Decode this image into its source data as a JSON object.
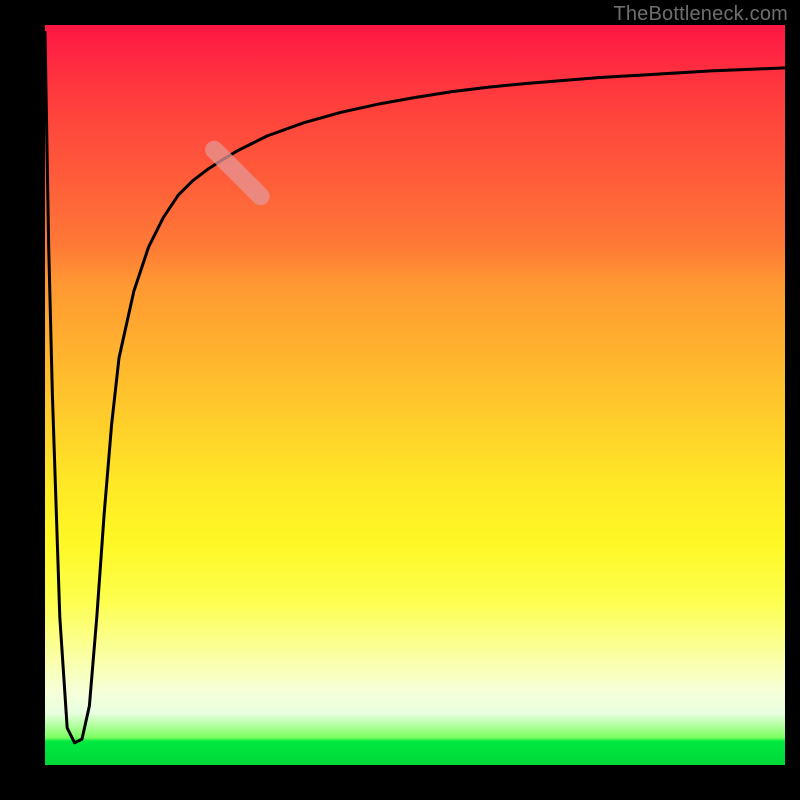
{
  "attribution": "TheBottleneck.com",
  "colors": {
    "background": "#000000",
    "curve": "#000000",
    "attribution_text": "#6e6e6e",
    "highlight_pill": "rgba(230,150,150,0.75)",
    "gradient_top": "#ff1744",
    "gradient_bottom": "#00d838"
  },
  "chart_data": {
    "type": "line",
    "title": "",
    "xlabel": "",
    "ylabel": "",
    "xlim": [
      0,
      1
    ],
    "ylim": [
      0,
      1
    ],
    "legend": false,
    "grid": false,
    "annotations": [
      {
        "kind": "highlight-pill",
        "x_range": [
          0.22,
          0.3
        ],
        "y_range": [
          0.76,
          0.84
        ]
      }
    ],
    "series": [
      {
        "name": "curve",
        "x": [
          0.0,
          0.005,
          0.01,
          0.02,
          0.03,
          0.04,
          0.05,
          0.06,
          0.07,
          0.08,
          0.09,
          0.1,
          0.12,
          0.14,
          0.16,
          0.18,
          0.2,
          0.22,
          0.24,
          0.26,
          0.28,
          0.3,
          0.35,
          0.4,
          0.45,
          0.5,
          0.55,
          0.6,
          0.65,
          0.7,
          0.75,
          0.8,
          0.85,
          0.9,
          0.95,
          1.0
        ],
        "y": [
          0.99,
          0.7,
          0.5,
          0.2,
          0.05,
          0.03,
          0.035,
          0.08,
          0.2,
          0.34,
          0.46,
          0.55,
          0.64,
          0.7,
          0.74,
          0.77,
          0.79,
          0.805,
          0.818,
          0.83,
          0.84,
          0.85,
          0.868,
          0.882,
          0.893,
          0.902,
          0.91,
          0.916,
          0.921,
          0.925,
          0.929,
          0.932,
          0.935,
          0.938,
          0.94,
          0.942
        ]
      }
    ]
  }
}
